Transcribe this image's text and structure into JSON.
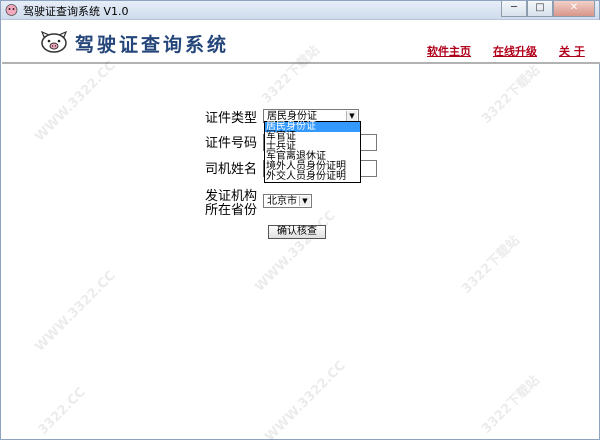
{
  "window": {
    "title": "驾驶证查询系统 V1.0",
    "controls": {
      "minimize": "─",
      "maximize": "□",
      "close": "✕"
    }
  },
  "header": {
    "app_name": "驾驶证查询系统",
    "nav": {
      "home": "软件主页",
      "upgrade": "在线升级",
      "about": "关 于"
    },
    "accent_color": "#b0001a",
    "brand_color": "#25467a"
  },
  "form": {
    "id_type_label": "证件类型",
    "id_type_value": "居民身份证",
    "id_type_options": [
      "居民身份证",
      "军官证",
      "士兵证",
      "军官离退休证",
      "境外人员身份证明",
      "外交人员身份证明"
    ],
    "id_type_selected_index": 0,
    "id_number_label": "证件号码",
    "driver_name_label": "司机姓名",
    "issuer_label_line1": "发证机构",
    "issuer_label_line2": "所在省份",
    "province_value": "北京市",
    "submit_label": "确认核查"
  },
  "watermark": {
    "brand": "3322下载站",
    "url": "WWW.3322.CC",
    "short": "3322.CC"
  }
}
